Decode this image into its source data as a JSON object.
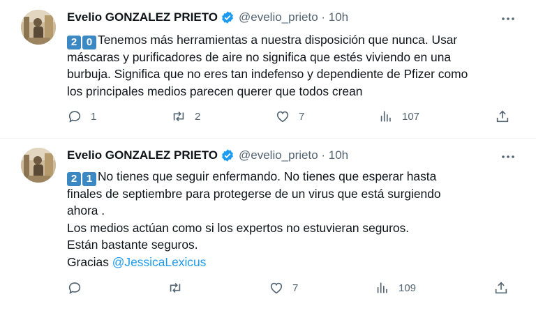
{
  "tweets": [
    {
      "author": "Evelio GONZALEZ PRIETO",
      "handle": "@evelio_prieto · 10h",
      "keycaps": [
        "2",
        "0"
      ],
      "lines": [
        "Tenemos más herramientas a nuestra disposición que nunca. Usar",
        "máscaras y purificadores de aire no significa que estés viviendo en una",
        "burbuja. Significa que no eres tan indefenso y dependiente de Pfizer como",
        "los principales medios parecen querer que todos crean"
      ],
      "actions": {
        "replies": "1",
        "retweets": "2",
        "likes": "7",
        "views": "107"
      }
    },
    {
      "author": "Evelio GONZALEZ PRIETO",
      "handle": "@evelio_prieto · 10h",
      "keycaps": [
        "2",
        "1"
      ],
      "lines": [
        "No tienes que seguir enfermando. No tienes que esperar hasta",
        "finales de septiembre para protegerse de un virus que está surgiendo",
        "ahora .",
        "Los medios actúan como si los expertos no estuvieran seguros.",
        "Están bastante seguros.",
        "Gracias"
      ],
      "mention": "@JessicaLexicus",
      "actions": {
        "replies": "",
        "retweets": "",
        "likes": "7",
        "views": "109"
      }
    }
  ],
  "colors": {
    "accent": "#1d9bf0",
    "secondary_text": "#536471",
    "keycap": "#3b88c3"
  },
  "icons": [
    "reply-icon",
    "retweet-icon",
    "like-icon",
    "views-icon",
    "share-icon",
    "more-icon",
    "verified-badge-icon"
  ]
}
